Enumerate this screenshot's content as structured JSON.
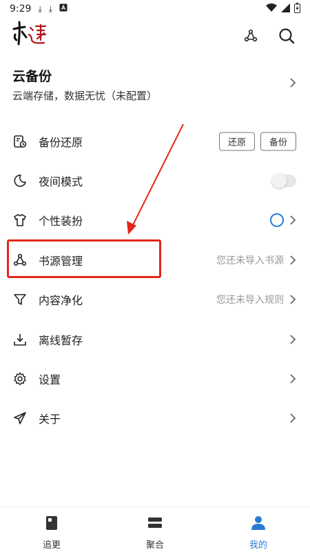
{
  "status_bar": {
    "time": "9:29"
  },
  "header": {
    "logo_text": "书迷",
    "source_icon": "share-nodes-icon",
    "search_icon": "search-icon"
  },
  "cloud": {
    "title": "云备份",
    "subtitle": "云端存储，数据无忧（未配置）"
  },
  "menu": {
    "items": [
      {
        "label": "备份还原",
        "icon": "backup-icon"
      },
      {
        "label": "夜间模式",
        "icon": "moon-icon"
      },
      {
        "label": "个性装扮",
        "icon": "shirt-icon"
      },
      {
        "label": "书源管理",
        "icon": "share-nodes-icon",
        "hint": "您还未导入书源"
      },
      {
        "label": "内容净化",
        "icon": "filter-icon",
        "hint": "您还未导入规则"
      },
      {
        "label": "离线暂存",
        "icon": "download-icon"
      },
      {
        "label": "设置",
        "icon": "gear-icon"
      },
      {
        "label": "关于",
        "icon": "send-icon"
      }
    ],
    "restore_label": "还原",
    "backup_label": "备份",
    "night_mode_on": false
  },
  "bottom_nav": {
    "items": [
      {
        "label": "追更",
        "icon": "book-icon"
      },
      {
        "label": "聚合",
        "icon": "stack-icon"
      },
      {
        "label": "我的",
        "icon": "person-icon"
      }
    ],
    "active_index": 2
  },
  "colors": {
    "accent": "#2a7bd3",
    "annotation": "#e3261c"
  }
}
